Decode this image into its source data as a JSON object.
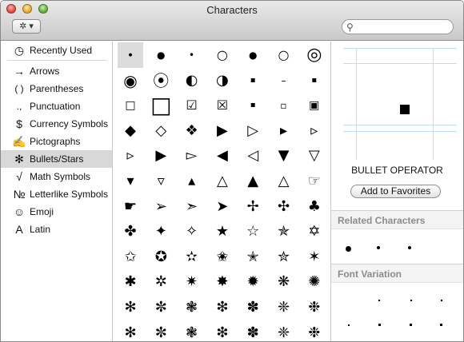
{
  "window": {
    "title": "Characters"
  },
  "toolbar": {
    "action_label": "✲ ▾",
    "search_placeholder": ""
  },
  "categories": [
    {
      "icon": "◷",
      "label": "Recently Used",
      "icon_name": "clock-icon"
    },
    {
      "icon": "→",
      "label": "Arrows",
      "icon_name": "arrow-icon"
    },
    {
      "icon": "( )",
      "label": "Parentheses",
      "icon_name": "parentheses-icon"
    },
    {
      "icon": ".,",
      "label": "Punctuation",
      "icon_name": "punctuation-icon"
    },
    {
      "icon": "$",
      "label": "Currency Symbols",
      "icon_name": "dollar-icon"
    },
    {
      "icon": "✍",
      "label": "Pictographs",
      "icon_name": "pictograph-icon"
    },
    {
      "icon": "✻",
      "label": "Bullets/Stars",
      "icon_name": "asterisk-icon"
    },
    {
      "icon": "√",
      "label": "Math Symbols",
      "icon_name": "square-root-icon"
    },
    {
      "icon": "№",
      "label": "Letterlike Symbols",
      "icon_name": "numero-icon"
    },
    {
      "icon": "☺",
      "label": "Emoji",
      "icon_name": "smiley-icon"
    },
    {
      "icon": "A",
      "label": "Latin",
      "icon_name": "latin-letter-icon"
    }
  ],
  "selected_category": "Bullets/Stars",
  "characters": [
    [
      "∙",
      "●",
      "•",
      "○",
      "●",
      "○",
      "◎"
    ],
    [
      "◉",
      "⦿",
      "◐",
      "◑",
      "▪",
      "–",
      "▪"
    ],
    [
      "□",
      "□",
      "☑",
      "☒",
      "▪",
      "▫",
      "▣"
    ],
    [
      "◆",
      "◇",
      "❖",
      "▶",
      "▷",
      "▸",
      "▹"
    ],
    [
      "▹",
      "▶",
      "▻",
      "◀",
      "◁",
      "▼",
      "▽"
    ],
    [
      "▾",
      "▿",
      "▴",
      "△",
      "▲",
      "△",
      "☞"
    ],
    [
      "☛",
      "➢",
      "➣",
      "➤",
      "✢",
      "✣",
      "♣"
    ],
    [
      "✤",
      "✦",
      "✧",
      "★",
      "☆",
      "✯",
      "✡"
    ],
    [
      "✩",
      "✪",
      "✫",
      "✬",
      "✭",
      "✮",
      "✶"
    ],
    [
      "✱",
      "✲",
      "✷",
      "✸",
      "✹",
      "❋",
      "✺"
    ],
    [
      "✻",
      "✼",
      "❃",
      "❇",
      "✽",
      "❈",
      "❉"
    ],
    [
      "✻",
      "✼",
      "❃",
      "❇",
      "✽",
      "❈",
      "❉"
    ]
  ],
  "selected_char": "∙",
  "info": {
    "name": "BULLET OPERATOR",
    "favorites_label": "Add to Favorites",
    "related_heading": "Related Characters",
    "related_chars": [
      "●",
      "•",
      "•"
    ],
    "font_variation_heading": "Font Variation"
  }
}
